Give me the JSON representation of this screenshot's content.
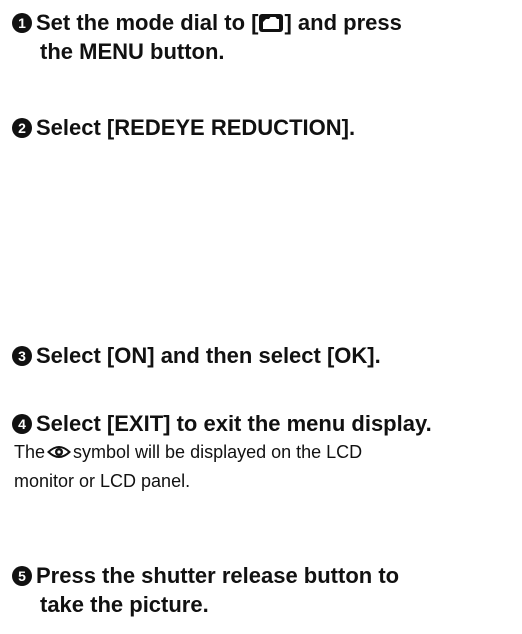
{
  "steps": [
    {
      "number": "1",
      "line1_before_icon": "Set the mode dial to [",
      "line1_after_icon": "] and press",
      "line2": "the MENU button."
    },
    {
      "number": "2",
      "text": "Select [REDEYE REDUCTION]."
    },
    {
      "number": "3",
      "text": "Select [ON] and then select [OK]."
    },
    {
      "number": "4",
      "text": "Select [EXIT] to exit the menu display.",
      "note_before_icon": "The",
      "note_after_icon": "symbol will be displayed on the LCD",
      "note_line2": "monitor or LCD panel."
    },
    {
      "number": "5",
      "line1": "Press the shutter release button to",
      "line2": "take the picture."
    }
  ],
  "icons": {
    "mode_dial_icon": "camera-icon",
    "redeye_symbol_icon": "eye-icon"
  }
}
